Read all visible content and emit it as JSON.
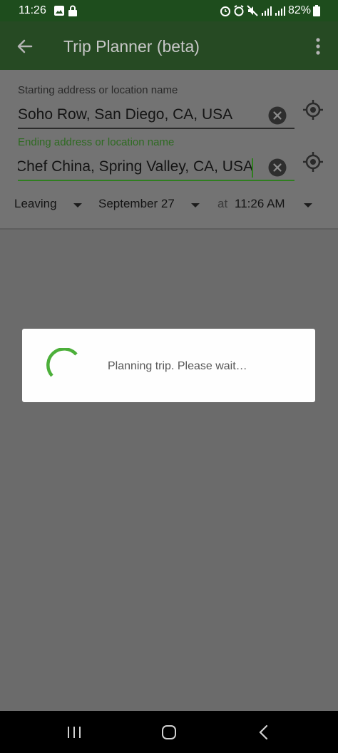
{
  "status_bar": {
    "time": "11:26",
    "battery": "82%"
  },
  "app_bar": {
    "title": "Trip Planner (beta)"
  },
  "form": {
    "start_label": "Starting address or location name",
    "start_value": "Soho Row, San Diego, CA, USA",
    "end_label": "Ending address or location name",
    "end_value": "Chef China, Spring Valley, CA, USA",
    "mode_value": "Leaving",
    "date_value": "September 27",
    "at_label": "at",
    "time_value": "11:26 AM"
  },
  "dialog": {
    "message": "Planning trip. Please wait…"
  },
  "colors": {
    "accent_green": "#4caf3a",
    "app_bar": "#264a23",
    "scrim": "#6b6b6b"
  }
}
